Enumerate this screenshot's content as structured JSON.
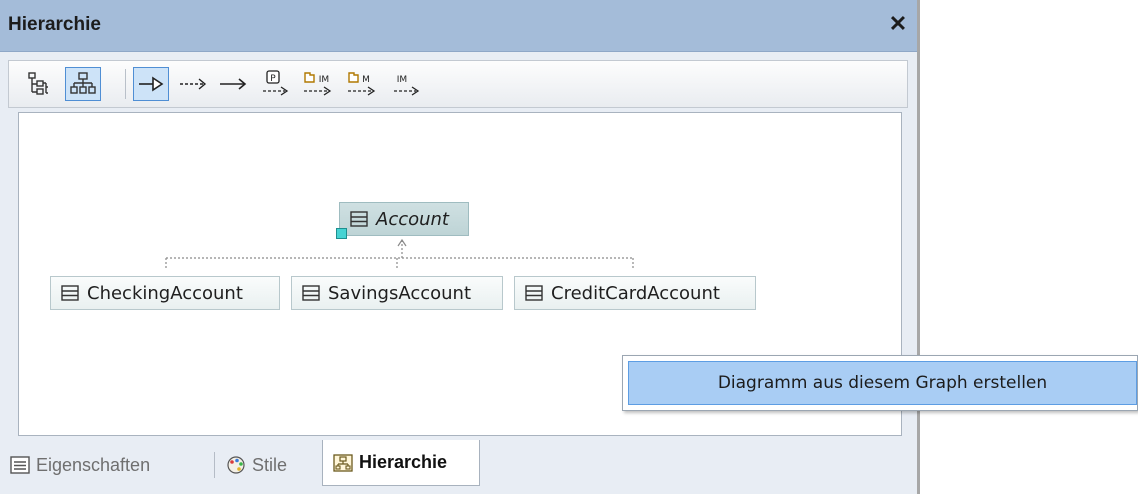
{
  "window": {
    "title": "Hierarchie",
    "close_label": "✕"
  },
  "toolbar": {
    "buttons": [
      {
        "name": "show-tree-view-icon",
        "active": false
      },
      {
        "name": "show-graph-view-icon",
        "active": true
      },
      {
        "name": "show-generalizations-icon",
        "active": true
      },
      {
        "name": "show-dependencies-icon",
        "active": false
      },
      {
        "name": "show-associations-icon",
        "active": false
      },
      {
        "name": "show-package-imports-icon",
        "active": false
      },
      {
        "name": "show-element-imports-icon",
        "active": false
      },
      {
        "name": "show-package-merges-icon",
        "active": false
      },
      {
        "name": "show-imports-icon",
        "active": false
      }
    ]
  },
  "graph": {
    "root": {
      "label": "Account",
      "italic": true,
      "selected": true
    },
    "children": [
      {
        "label": "CheckingAccount"
      },
      {
        "label": "SavingsAccount"
      },
      {
        "label": "CreditCardAccount"
      }
    ]
  },
  "context_menu": {
    "item": "Diagramm aus diesem Graph erstellen"
  },
  "tabs": [
    {
      "label": "Eigenschaften",
      "icon": "properties-icon",
      "active": false
    },
    {
      "label": "Stile",
      "icon": "palette-icon",
      "active": false
    },
    {
      "label": "Hierarchie",
      "icon": "hierarchy-icon",
      "active": true
    }
  ],
  "colors": {
    "titlebar": "#a4bcd9",
    "menu_highlight": "#a9cdf4",
    "node_selected": "#c6dadc"
  }
}
